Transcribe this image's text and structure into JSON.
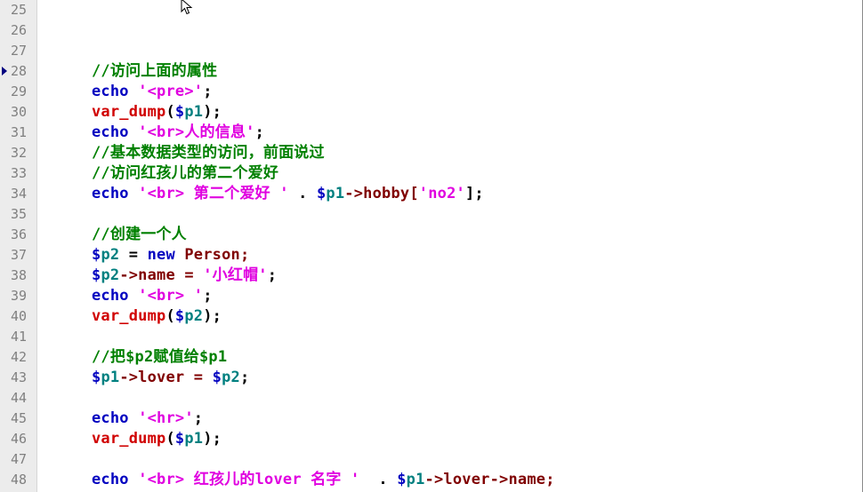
{
  "colors": {
    "comment": "#008000",
    "keyword": "#0000c0",
    "string": "#e000e0",
    "variable": "#008080",
    "dollar": "#0000c0",
    "default": "#800000",
    "builtin": "#d00000",
    "operator": "#000000"
  },
  "editor": {
    "current_line": 28,
    "lines": [
      {
        "n": "25",
        "tokens": []
      },
      {
        "n": "26",
        "tokens": []
      },
      {
        "n": "27",
        "tokens": []
      },
      {
        "n": "28",
        "tokens": [
          {
            "t": "//访问上面的属性",
            "c": "comment"
          }
        ]
      },
      {
        "n": "29",
        "tokens": [
          {
            "t": "echo",
            "c": "keyword"
          },
          {
            "t": " ",
            "c": "operator"
          },
          {
            "t": "'<pre>'",
            "c": "string"
          },
          {
            "t": ";",
            "c": "operator"
          }
        ]
      },
      {
        "n": "30",
        "tokens": [
          {
            "t": "var_dump",
            "c": "builtin"
          },
          {
            "t": "(",
            "c": "operator"
          },
          {
            "t": "$",
            "c": "dollar"
          },
          {
            "t": "p1",
            "c": "variable"
          },
          {
            "t": ");",
            "c": "operator"
          }
        ]
      },
      {
        "n": "31",
        "tokens": [
          {
            "t": "echo",
            "c": "keyword"
          },
          {
            "t": " ",
            "c": "operator"
          },
          {
            "t": "'<br>人的信息'",
            "c": "string"
          },
          {
            "t": ";",
            "c": "operator"
          }
        ]
      },
      {
        "n": "32",
        "tokens": [
          {
            "t": "//基本数据类型的访问，前面说过",
            "c": "comment"
          }
        ]
      },
      {
        "n": "33",
        "tokens": [
          {
            "t": "//访问红孩儿的第二个爱好",
            "c": "comment"
          }
        ]
      },
      {
        "n": "34",
        "tokens": [
          {
            "t": "echo",
            "c": "keyword"
          },
          {
            "t": " ",
            "c": "operator"
          },
          {
            "t": "'<br> 第二个爱好 '",
            "c": "string"
          },
          {
            "t": " . ",
            "c": "operator"
          },
          {
            "t": "$",
            "c": "dollar"
          },
          {
            "t": "p1",
            "c": "variable"
          },
          {
            "t": "->hobby[",
            "c": "default"
          },
          {
            "t": "'no2'",
            "c": "string"
          },
          {
            "t": "];",
            "c": "operator"
          }
        ]
      },
      {
        "n": "35",
        "tokens": []
      },
      {
        "n": "36",
        "tokens": [
          {
            "t": "//创建一个人",
            "c": "comment"
          }
        ]
      },
      {
        "n": "37",
        "tokens": [
          {
            "t": "$",
            "c": "dollar"
          },
          {
            "t": "p2",
            "c": "variable"
          },
          {
            "t": " = ",
            "c": "operator"
          },
          {
            "t": "new",
            "c": "keyword"
          },
          {
            "t": " Person;",
            "c": "default"
          }
        ]
      },
      {
        "n": "38",
        "tokens": [
          {
            "t": "$",
            "c": "dollar"
          },
          {
            "t": "p2",
            "c": "variable"
          },
          {
            "t": "->name = ",
            "c": "default"
          },
          {
            "t": "'小红帽'",
            "c": "string"
          },
          {
            "t": ";",
            "c": "operator"
          }
        ]
      },
      {
        "n": "39",
        "tokens": [
          {
            "t": "echo",
            "c": "keyword"
          },
          {
            "t": " ",
            "c": "operator"
          },
          {
            "t": "'<br> '",
            "c": "string"
          },
          {
            "t": ";",
            "c": "operator"
          }
        ]
      },
      {
        "n": "40",
        "tokens": [
          {
            "t": "var_dump",
            "c": "builtin"
          },
          {
            "t": "(",
            "c": "operator"
          },
          {
            "t": "$",
            "c": "dollar"
          },
          {
            "t": "p2",
            "c": "variable"
          },
          {
            "t": ");",
            "c": "operator"
          }
        ]
      },
      {
        "n": "41",
        "tokens": []
      },
      {
        "n": "42",
        "tokens": [
          {
            "t": "//把$p2赋值给$p1",
            "c": "comment"
          }
        ]
      },
      {
        "n": "43",
        "tokens": [
          {
            "t": "$",
            "c": "dollar"
          },
          {
            "t": "p1",
            "c": "variable"
          },
          {
            "t": "->lover = ",
            "c": "default"
          },
          {
            "t": "$",
            "c": "dollar"
          },
          {
            "t": "p2",
            "c": "variable"
          },
          {
            "t": ";",
            "c": "operator"
          }
        ]
      },
      {
        "n": "44",
        "tokens": []
      },
      {
        "n": "45",
        "tokens": [
          {
            "t": "echo",
            "c": "keyword"
          },
          {
            "t": " ",
            "c": "operator"
          },
          {
            "t": "'<hr>'",
            "c": "string"
          },
          {
            "t": ";",
            "c": "operator"
          }
        ]
      },
      {
        "n": "46",
        "tokens": [
          {
            "t": "var_dump",
            "c": "builtin"
          },
          {
            "t": "(",
            "c": "operator"
          },
          {
            "t": "$",
            "c": "dollar"
          },
          {
            "t": "p1",
            "c": "variable"
          },
          {
            "t": ");",
            "c": "operator"
          }
        ]
      },
      {
        "n": "47",
        "tokens": []
      },
      {
        "n": "48",
        "tokens": [
          {
            "t": "echo",
            "c": "keyword"
          },
          {
            "t": " ",
            "c": "operator"
          },
          {
            "t": "'<br> 红孩儿的lover 名字 '",
            "c": "string"
          },
          {
            "t": "  . ",
            "c": "operator"
          },
          {
            "t": "$",
            "c": "dollar"
          },
          {
            "t": "p1",
            "c": "variable"
          },
          {
            "t": "->lover->name;",
            "c": "default"
          }
        ]
      }
    ]
  }
}
